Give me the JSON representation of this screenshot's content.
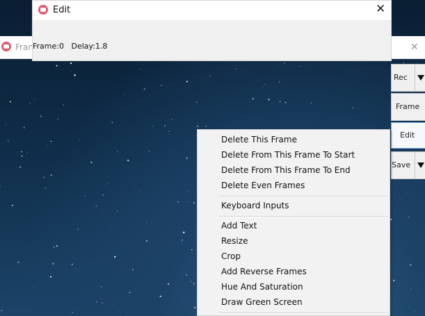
{
  "background_window": {
    "title": "Fran",
    "icon": "screentogif-app-icon",
    "close_icon": "close-icon"
  },
  "toolbar": {
    "rec_label": "Rec",
    "frame_label": "Frame",
    "edit_label": "Edit",
    "save_label": "Save",
    "dropdown_icon": "chevron-down-icon"
  },
  "edit_window": {
    "title": "Edit",
    "icon": "screentogif-app-icon",
    "close_label": "✕",
    "frame_label": "Frame:",
    "frame_value": "0",
    "delay_label": "Delay:",
    "delay_value": "1.8"
  },
  "context_menu": {
    "group1": [
      "Delete This Frame",
      "Delete From This Frame To Start",
      "Delete From This Frame To End",
      "Delete Even Frames"
    ],
    "group2": [
      "Keyboard Inputs"
    ],
    "group3": [
      "Add Text",
      "Resize",
      "Crop",
      "Add Reverse Frames",
      "Hue And Saturation",
      "Draw Green Screen"
    ]
  },
  "colors": {
    "app_icon": "#e05a70",
    "sky_dark": "#0a1e33",
    "sky_light": "#2d5d86",
    "menu_bg": "#f2f2f2",
    "dialog_bg": "#f0f0f0",
    "active_tab_border": "#7aaee0"
  }
}
